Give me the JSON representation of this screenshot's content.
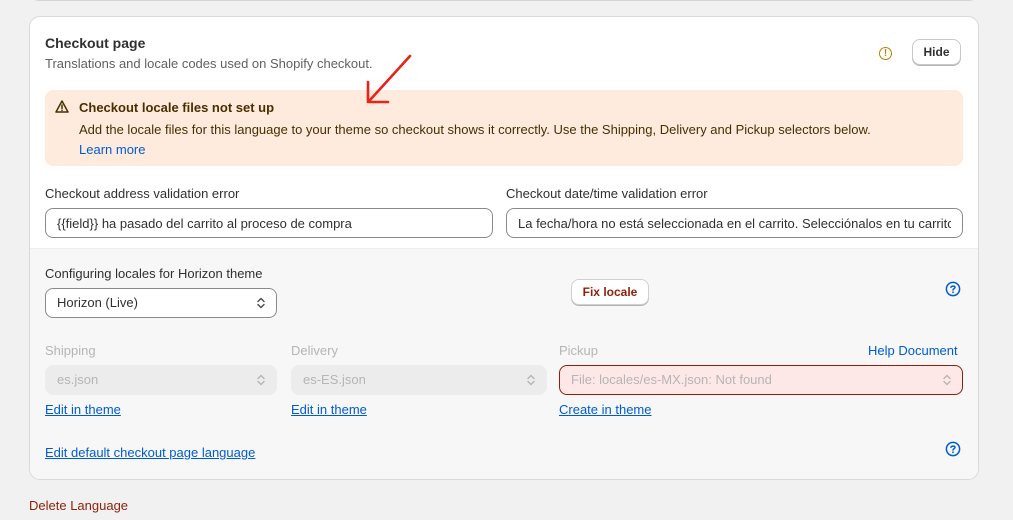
{
  "card": {
    "title": "Checkout page",
    "subtitle": "Translations and locale codes used on Shopify checkout.",
    "hide_label": "Hide",
    "warn_symbol": "!"
  },
  "banner": {
    "icon": "warning-triangle-icon",
    "title": "Checkout locale files not set up",
    "text": "Add the locale files for this language to your theme so checkout shows it correctly. Use the Shipping, Delivery and Pickup selectors below.",
    "link": "Learn more"
  },
  "fields": {
    "address_label": "Checkout address validation error",
    "address_value": "{{field}} ha pasado del carrito al proceso de compra",
    "datetime_label": "Checkout date/time validation error",
    "datetime_value": "La fecha/hora no está seleccionada en el carrito. Selecciónalos en tu carrito"
  },
  "locales": {
    "config_label": "Configuring locales for Horizon theme",
    "theme_select": "Horizon (Live)",
    "fix_button": "Fix locale",
    "shipping_label": "Shipping",
    "shipping_value": "es.json",
    "shipping_link": "Edit in theme",
    "delivery_label": "Delivery",
    "delivery_value": "es-ES.json",
    "delivery_link": "Edit in theme",
    "pickup_label": "Pickup",
    "pickup_value": "File: locales/es-MX.json: Not found",
    "pickup_link": "Create in theme",
    "help_document": "Help Document",
    "edit_default": "Edit default checkout page language"
  },
  "footer": {
    "delete_language": "Delete Language"
  },
  "colors": {
    "banner_bg": "#ffebdd",
    "link": "#005bd3",
    "critical": "#8e1f0b",
    "warning_icon": "#b28400",
    "annotation_arrow": "#e8231a"
  }
}
